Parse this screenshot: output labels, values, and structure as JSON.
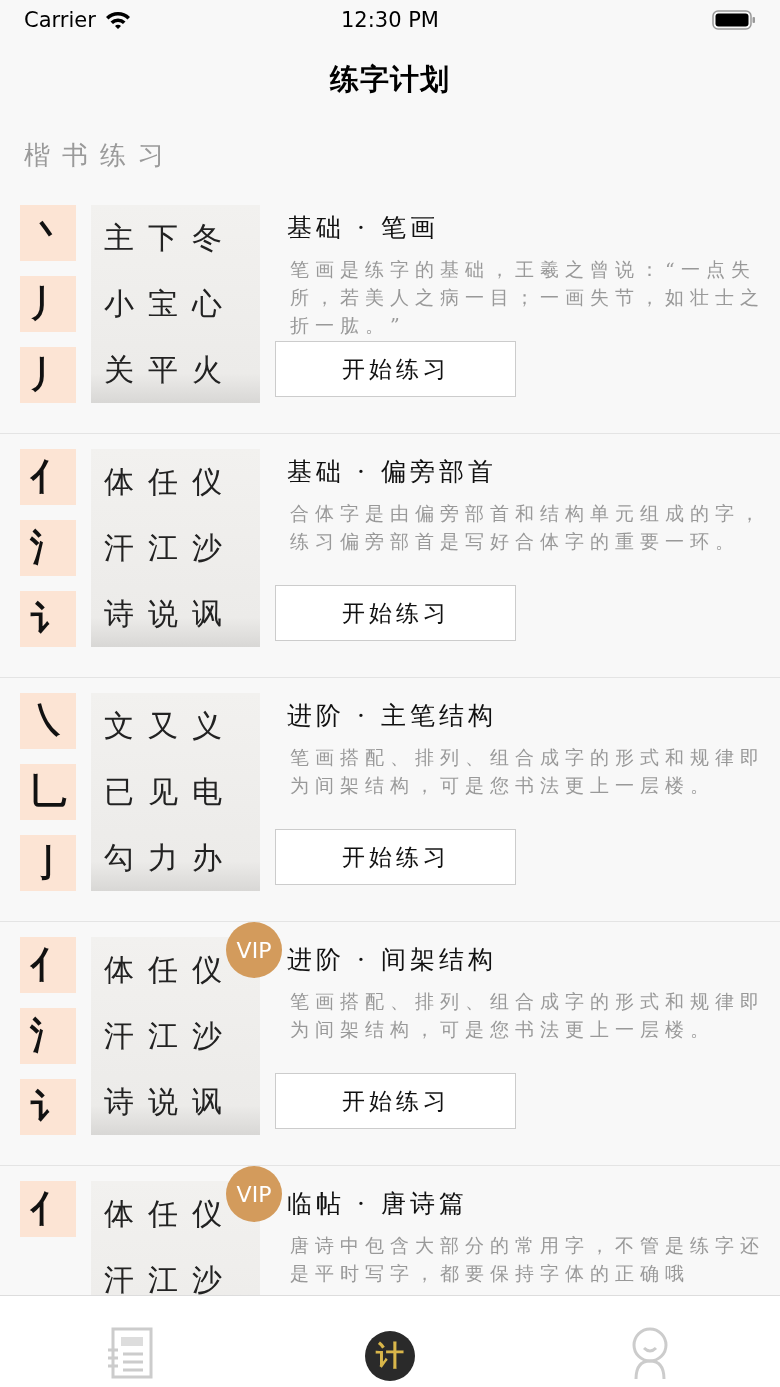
{
  "status_bar": {
    "carrier": "Carrier",
    "time": "12:30 PM"
  },
  "nav": {
    "title": "练字计划"
  },
  "section": {
    "title": "楷书练习"
  },
  "cards": [
    {
      "strokes": [
        "丶",
        "丿",
        "丿"
      ],
      "characters": [
        [
          "主",
          "下",
          "冬"
        ],
        [
          "小",
          "宝",
          "心"
        ],
        [
          "关",
          "平",
          "火"
        ]
      ],
      "title": "基础 · 笔画",
      "description": "笔画是练字的基础，王羲之曾说：“一点失所，若美人之病一目；一画失节，如壮士之折一肱。”",
      "button": "开始练习",
      "vip": false
    },
    {
      "strokes": [
        "亻",
        "氵",
        "讠"
      ],
      "characters": [
        [
          "体",
          "任",
          "仪"
        ],
        [
          "汗",
          "江",
          "沙"
        ],
        [
          "诗",
          "说",
          "讽"
        ]
      ],
      "title": "基础 · 偏旁部首",
      "description": "合体字是由偏旁部首和结构单元组成的字，练习偏旁部首是写好合体字的重要一环。",
      "button": "开始练习",
      "vip": false
    },
    {
      "strokes": [
        "㇏",
        "乚",
        "亅"
      ],
      "characters": [
        [
          "文",
          "又",
          "义"
        ],
        [
          "已",
          "见",
          "电"
        ],
        [
          "勾",
          "力",
          "办"
        ]
      ],
      "title": "进阶 · 主笔结构",
      "description": "笔画搭配、排列、组合成字的形式和规律即为间架结构，可是您书法更上一层楼。",
      "button": "开始练习",
      "vip": false
    },
    {
      "strokes": [
        "亻",
        "氵",
        "讠"
      ],
      "characters": [
        [
          "体",
          "任",
          "仪"
        ],
        [
          "汗",
          "江",
          "沙"
        ],
        [
          "诗",
          "说",
          "讽"
        ]
      ],
      "title": "进阶 · 间架结构",
      "description": "笔画搭配、排列、组合成字的形式和规律即为间架结构，可是您书法更上一层楼。",
      "button": "开始练习",
      "vip": true,
      "vip_label": "VIP"
    },
    {
      "strokes": [
        "亻"
      ],
      "characters": [
        [
          "体",
          "任",
          "仪"
        ],
        [
          "汗",
          "江",
          "沙"
        ]
      ],
      "title": "临帖 · 唐诗篇",
      "description": "唐诗中包含大部分的常用字，不管是练字还是平时写字，都要保持字体的正确哦",
      "vip": true,
      "vip_label": "VIP"
    }
  ],
  "tab_bar": [
    {
      "kind": "list",
      "selected": false
    },
    {
      "kind": "plan",
      "label": "计",
      "selected": true
    },
    {
      "kind": "profile",
      "selected": false
    }
  ]
}
